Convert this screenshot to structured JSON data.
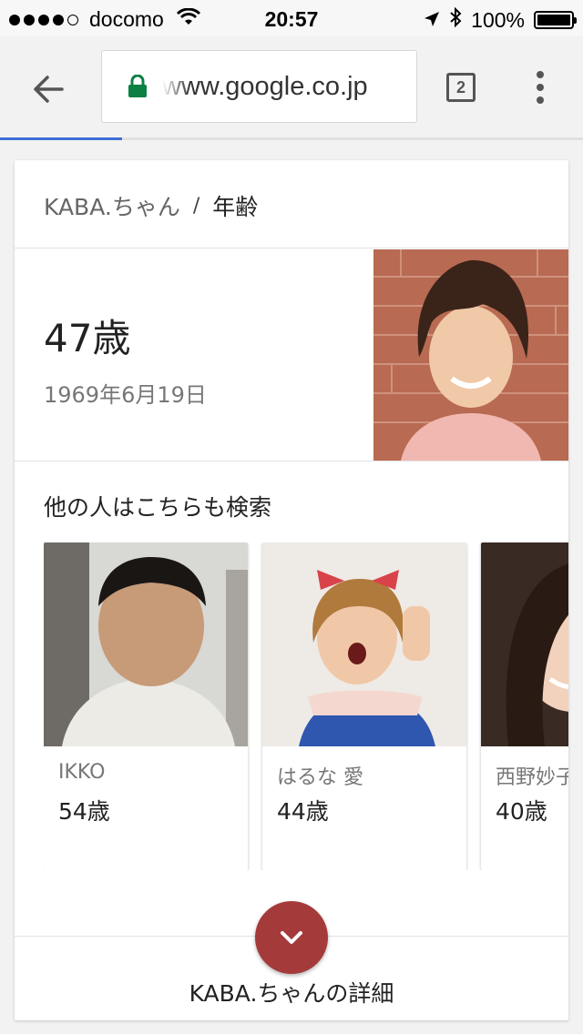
{
  "status_bar": {
    "carrier": "docomo",
    "signal_bars": 4,
    "time": "20:57",
    "battery": "100%",
    "battery_level": 1.0
  },
  "browser": {
    "url": "www.google.co.jp",
    "tab_count": "2",
    "page_load_progress": 0.21,
    "icons": {
      "back": "arrow-left-icon",
      "lock": "lock-icon",
      "menu": "more-vertical-icon"
    },
    "colors": {
      "lock": "#0b8043",
      "progress": "#3f6fd6"
    }
  },
  "knowledge_card": {
    "breadcrumb": {
      "entity": "KABA.ちゃん",
      "separator": "/",
      "attribute": "年齢"
    },
    "age": "47歳",
    "birth_date": "1969年6月19日",
    "related": {
      "title": "他の人はこちらも検索",
      "people": [
        {
          "name": "IKKO",
          "age": "54歳"
        },
        {
          "name": "はるな 愛",
          "age": "44歳"
        },
        {
          "name": "西野妙子",
          "age": "40歳"
        }
      ]
    },
    "details_link": "KABA.ちゃんの詳細",
    "expand_icon": "chevron-down-icon",
    "accent_color": "#a53a3a"
  }
}
